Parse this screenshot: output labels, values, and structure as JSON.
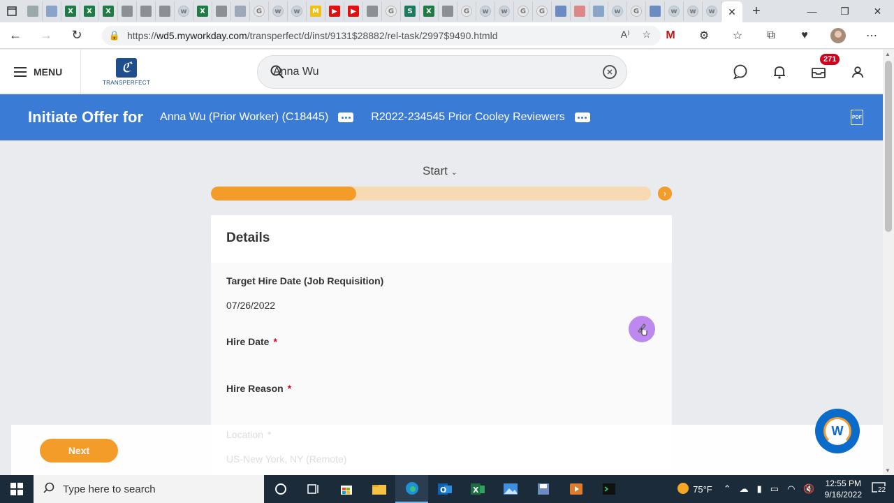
{
  "browser": {
    "url_prefix": "https://",
    "url_domain": "wd5.myworkday.com",
    "url_path": "/transperfect/d/inst/9131$28882/rel-task/2997$9490.htmld",
    "tab_favicons": [
      "page",
      "search",
      "X",
      "X",
      "X",
      "gray",
      "gray",
      "gray",
      "W",
      "X",
      "gray",
      "tool",
      "G",
      "W",
      "W",
      "M",
      "yt",
      "yt",
      "gray",
      "G",
      "S",
      "X",
      "gray",
      "G",
      "W",
      "W",
      "G",
      "G",
      "mail",
      "pin",
      "search",
      "W",
      "G",
      "mail",
      "W",
      "W",
      "W"
    ]
  },
  "header": {
    "menu_label": "MENU",
    "logo_text": "TRANSPERFECT",
    "search_value": "Anna Wu",
    "inbox_count": "271"
  },
  "titlebar": {
    "title": "Initiate Offer for",
    "worker": "Anna Wu (Prior Worker) (C18445)",
    "requisition": "R2022-234545 Prior Cooley Reviewers",
    "pdf_label": "PDF"
  },
  "progress": {
    "step_label": "Start",
    "fraction": 0.33
  },
  "details": {
    "heading": "Details",
    "target_hire_label": "Target Hire Date (Job Requisition)",
    "target_hire_value": "07/26/2022",
    "hire_date_label": "Hire Date",
    "hire_reason_label": "Hire Reason",
    "location_label": "Location",
    "location_value": "US-New York, NY (Remote)",
    "required_mark": "*"
  },
  "footer": {
    "next_label": "Next",
    "chat_label": "W"
  },
  "taskbar": {
    "search_placeholder": "Type here to search",
    "weather": "75°F",
    "time": "12:55 PM",
    "date": "9/16/2022",
    "notifications": "22"
  },
  "colors": {
    "workday_blue": "#3a7bd5",
    "orange": "#f39c2a",
    "progress_track": "#f7d9b3",
    "required_red": "#d0021b"
  }
}
